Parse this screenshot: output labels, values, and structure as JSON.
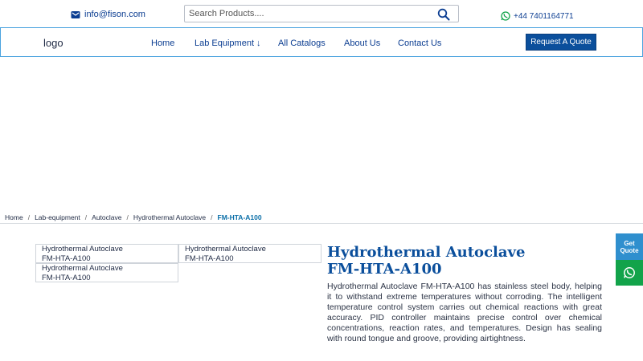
{
  "header": {
    "email": "info@fison.com",
    "search_placeholder": "Search Products....",
    "phone": "+44 7401164771",
    "icons": {
      "email": "envelope-icon",
      "search": "search-icon",
      "phone": "whatsapp-icon"
    }
  },
  "nav": {
    "logo": "logo",
    "items": [
      {
        "label": "Home"
      },
      {
        "label": "Lab Equipment ↓"
      },
      {
        "label": "All Catalogs"
      },
      {
        "label": "About Us"
      },
      {
        "label": "Contact Us"
      }
    ],
    "quote_button": "Request A Quote"
  },
  "breadcrumb": {
    "items": [
      "Home",
      "Lab-equipment",
      "Autoclave",
      "Hydrothermal Autoclave"
    ],
    "current": "FM-HTA-A100",
    "separator": "/"
  },
  "thumbnails": [
    {
      "line1": "Hydrothermal Autoclave",
      "line2": "FM-HTA-A100"
    },
    {
      "line1": "Hydrothermal Autoclave",
      "line2": "FM-HTA-A100"
    },
    {
      "line1": "Hydrothermal Autoclave",
      "line2": "FM-HTA-A100"
    }
  ],
  "product": {
    "title_line1": "Hydrothermal Autoclave",
    "title_line2": "FM-HTA-A100",
    "description": "Hydrothermal Autoclave FM-HTA-A100 has stainless steel body, helping it to withstand extreme temperatures without corroding. The intelligent temperature control system carries out chemical reactions with great accuracy. PID controller maintains precise control over chemical concentrations, reaction rates, and temperatures. Design has sealing with round tongue and groove, providing airtightness."
  },
  "side": {
    "quote_line1": "Get",
    "quote_line2": "Quote",
    "whatsapp_icon": "whatsapp-icon"
  },
  "colors": {
    "brand": "#0b4f9c",
    "accent_border": "#4aa3df",
    "side_quote": "#2f8fce",
    "whatsapp": "#12a34a"
  }
}
